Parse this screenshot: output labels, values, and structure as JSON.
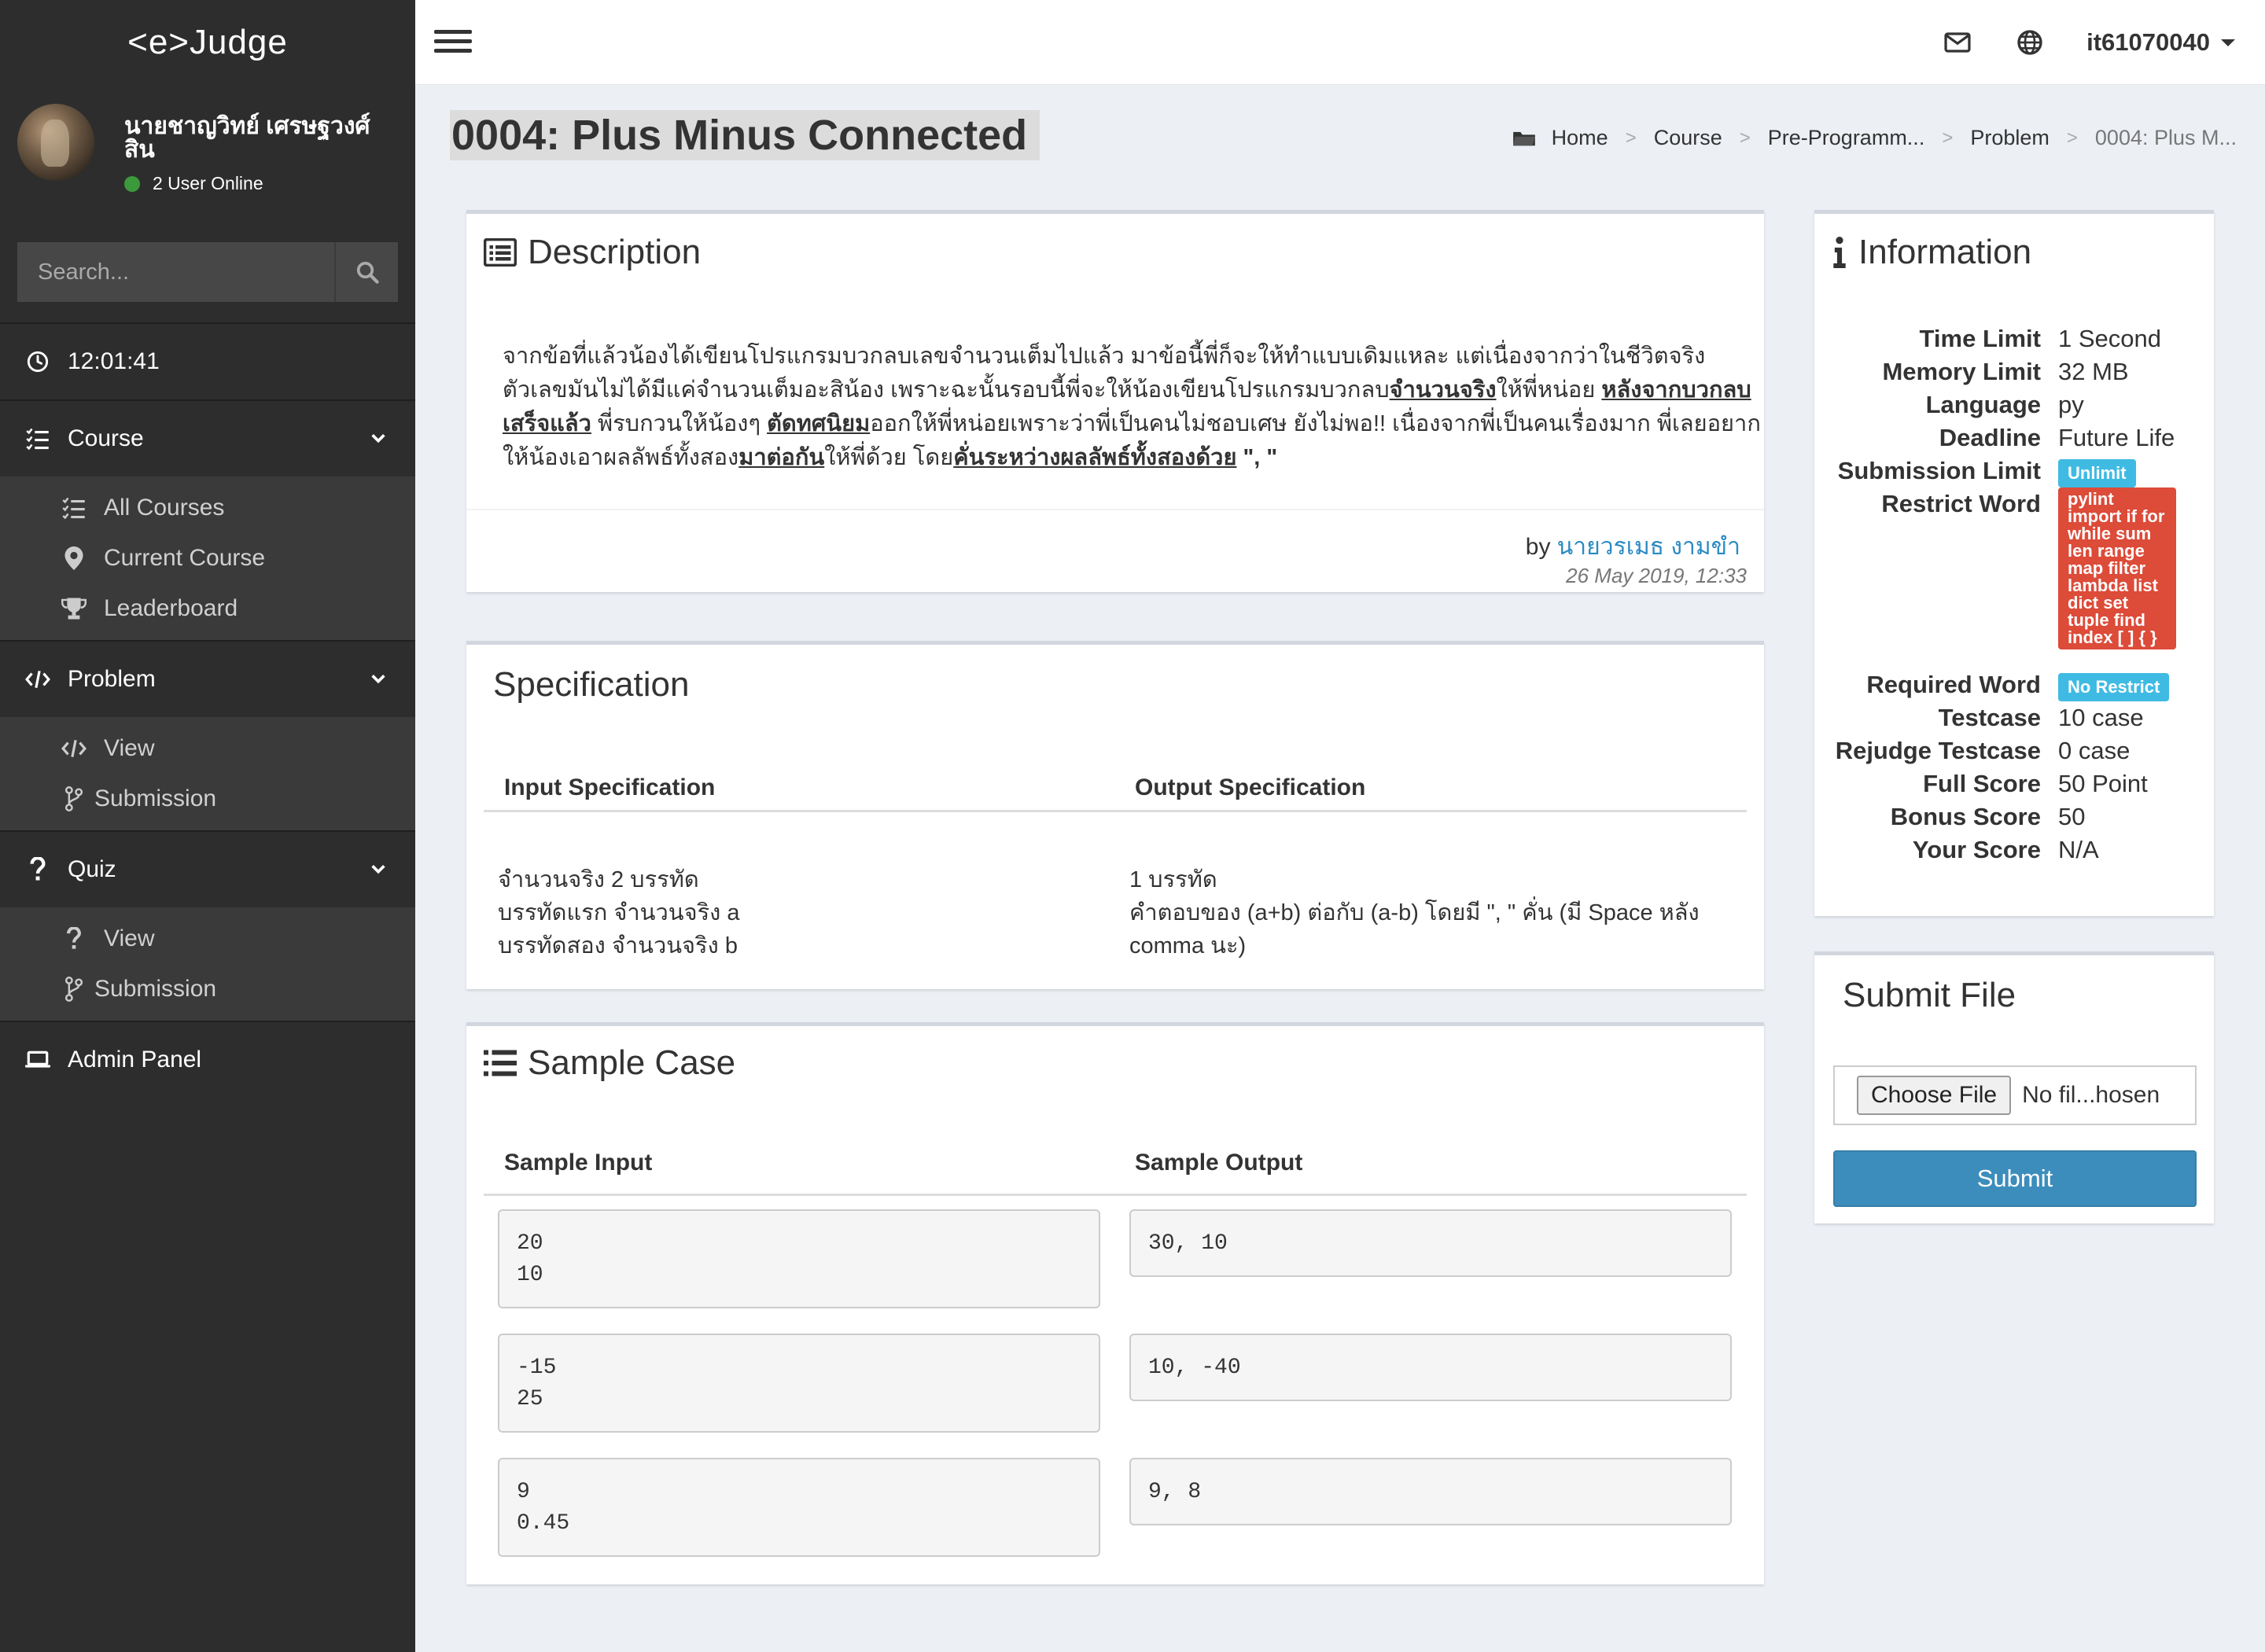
{
  "app": {
    "logo": "<e>Judge"
  },
  "user": {
    "name": "นายชาญวิทย์ เศรษฐวงศ์สิน",
    "status": "2 User Online",
    "username": "it61070040"
  },
  "search": {
    "placeholder": "Search..."
  },
  "clock": {
    "time": "12:01:41"
  },
  "menu": {
    "course": {
      "label": "Course",
      "items": [
        "All Courses",
        "Current Course",
        "Leaderboard"
      ]
    },
    "problem": {
      "label": "Problem",
      "items": [
        "View",
        "Submission"
      ]
    },
    "quiz": {
      "label": "Quiz",
      "items": [
        "View",
        "Submission"
      ]
    },
    "admin": {
      "label": "Admin Panel"
    }
  },
  "page": {
    "title": "0004: Plus Minus Connected"
  },
  "breadcrumb": [
    "Home",
    "Course",
    "Pre-Programm...",
    "Problem",
    "0004: Plus M..."
  ],
  "description": {
    "title": "Description",
    "segments": [
      {
        "text": "จากข้อที่แล้วน้องได้เขียนโปรแกรมบวกลบเลขจำนวนเต็มไปแล้ว มาข้อนี้พี่ก็จะให้ทำแบบเดิมแหละ แต่เนื่องจากว่าในชีวิตจริงตัวเลขมันไม่ได้มีแค่จำนวนเต็มอะสิน้อง เพราะฉะนั้นรอบนี้พี่จะให้น้องเขียนโปรแกรมบวกลบ",
        "bold": false
      },
      {
        "text": "จำนวนจริง",
        "bold": true
      },
      {
        "text": "ให้พี่หน่อย ",
        "bold": false
      },
      {
        "text": "หลังจากบวกลบเสร็จแล้ว",
        "bold": true
      },
      {
        "text": "  พี่รบกวนให้น้องๆ ",
        "bold": false
      },
      {
        "text": "ตัดทศนิยม",
        "bold": true
      },
      {
        "text": "ออกให้พี่หน่อยเพราะว่าพี่เป็นคนไม่ชอบเศษ ยังไม่พอ!! เนื่องจากพี่เป็นคนเรื่องมาก พี่เลยอยากให้น้องเอาผลลัพธ์ทั้งสอง",
        "bold": false
      },
      {
        "text": "มาต่อกัน",
        "bold": true
      },
      {
        "text": "ให้พี่ด้วย โดย",
        "bold": false
      },
      {
        "text": "คั่นระหว่างผลลัพธ์ทั้งสองด้วย",
        "bold": true
      },
      {
        "text": " \", \"",
        "bold": false
      }
    ],
    "by_prefix": "by",
    "author": "นายวรเมธ งามขำ",
    "date": "26 May 2019, 12:33"
  },
  "specification": {
    "title": "Specification",
    "input_header": "Input Specification",
    "output_header": "Output Specification",
    "input_lines": [
      "จำนวนจริง 2 บรรทัด",
      "บรรทัดแรก จำนวนจริง a",
      "บรรทัดสอง จำนวนจริง b"
    ],
    "output_lines": [
      "1 บรรทัด",
      "คำตอบของ (a+b) ต่อกับ (a-b) โดยมี \", \" คั่น (มี Space หลัง",
      "comma นะ)"
    ]
  },
  "sample": {
    "title": "Sample Case",
    "input_header": "Sample Input",
    "output_header": "Sample Output",
    "cases": [
      {
        "input": "20\n10",
        "output": "30, 10"
      },
      {
        "input": "-15\n25",
        "output": "10, -40"
      },
      {
        "input": "9\n0.45",
        "output": "9, 8"
      }
    ]
  },
  "information": {
    "title": "Information",
    "rows": {
      "time_limit": {
        "label": "Time Limit",
        "value": "1 Second"
      },
      "memory_limit": {
        "label": "Memory Limit",
        "value": "32 MB"
      },
      "language": {
        "label": "Language",
        "value": "py"
      },
      "deadline": {
        "label": "Deadline",
        "value": "Future Life"
      },
      "submission_limit": {
        "label": "Submission Limit",
        "value": "Unlimit"
      },
      "restrict_word": {
        "label": "Restrict Word",
        "value": "pylint import if for while sum len range map filter lambda list dict set tuple find index [ ] { }"
      },
      "required_word": {
        "label": "Required Word",
        "value": "No Restrict"
      },
      "testcase": {
        "label": "Testcase",
        "value": "10 case"
      },
      "rejudge_testcase": {
        "label": "Rejudge Testcase",
        "value": "0 case"
      },
      "full_score": {
        "label": "Full Score",
        "value": "50 Point"
      },
      "bonus_score": {
        "label": "Bonus Score",
        "value": "50"
      },
      "your_score": {
        "label": "Your Score",
        "value": "N/A"
      }
    }
  },
  "submit": {
    "title": "Submit File",
    "choose_label": "Choose File",
    "file_status": "No fil...hosen",
    "button": "Submit"
  },
  "colors": {
    "sidebar": "#2d2d2d",
    "primary": "#3c8dbc",
    "info_badge": "#3fbbe3",
    "danger_badge": "#dd4b39",
    "link": "#2a8ac4"
  },
  "icons": [
    "envelope-icon",
    "globe-icon",
    "clock-icon",
    "search-icon",
    "tasks-icon",
    "map-marker-icon",
    "trophy-icon",
    "code-icon",
    "code-fork-icon",
    "question-icon",
    "laptop-icon",
    "list-alt-icon",
    "info-icon",
    "list-icon",
    "folder-icon"
  ]
}
